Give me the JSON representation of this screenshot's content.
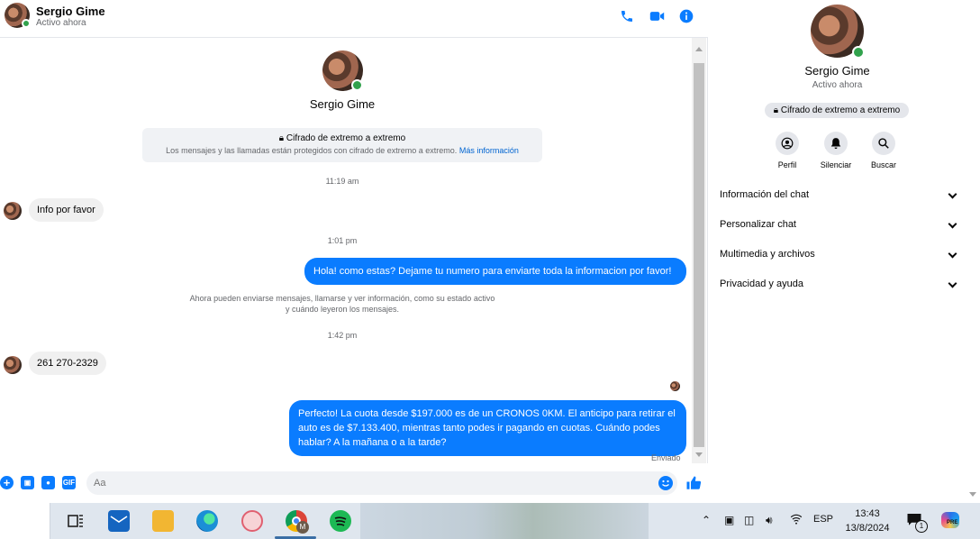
{
  "header": {
    "name": "Sergio Gime",
    "status": "Activo ahora"
  },
  "thread": {
    "title_name": "Sergio Gime",
    "e2e_title": "Cifrado de extremo a extremo",
    "e2e_sub": "Los mensajes y las llamadas están protegidos con cifrado de extremo a extremo.",
    "e2e_link": "Más información",
    "messages": [
      {
        "time": "11:19 am"
      },
      {
        "incoming": "Info por favor"
      },
      {
        "time": "1:01 pm"
      },
      {
        "outgoing": "Hola! como estas? Dejame tu numero para enviarte toda la informacion por favor!"
      },
      {
        "notice": "Ahora pueden enviarse mensajes, llamarse y ver información, como su estado activo y cuándo leyeron los mensajes."
      },
      {
        "time": "1:42 pm"
      },
      {
        "incoming": "261 270-2329"
      },
      {
        "outgoing": "Perfecto! La cuota desde $197.000 es de un CRONOS 0KM. El anticipo para retirar el auto es de $7.133.400, mientras tanto podes ir pagando en cuotas. Cuándo podes hablar? A la mañana o a la tarde?"
      }
    ],
    "sent_status": "Enviado"
  },
  "composer": {
    "placeholder": "Aa",
    "gif_label": "GIF"
  },
  "info_panel": {
    "name": "Sergio Gime",
    "status": "Activo ahora",
    "e2e_label": "Cifrado de extremo a extremo",
    "actions": [
      {
        "label": "Perfil",
        "icon": "profile-icon"
      },
      {
        "label": "Silenciar",
        "icon": "bell-icon"
      },
      {
        "label": "Buscar",
        "icon": "search-icon"
      }
    ],
    "sections": [
      "Información del chat",
      "Personalizar chat",
      "Multimedia y archivos",
      "Privacidad y ayuda"
    ]
  },
  "taskbar": {
    "language": "ESP",
    "time": "13:43",
    "date": "13/8/2024",
    "notification_count": "1",
    "chrome_badge": "M",
    "copilot_badge": "PRE"
  },
  "colors": {
    "accent": "#0a7cff",
    "online": "#31a24c",
    "link": "#0064d1"
  }
}
